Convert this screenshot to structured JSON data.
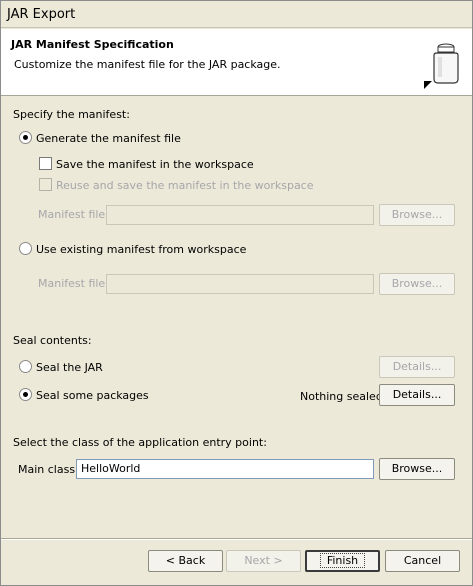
{
  "window": {
    "title": "JAR Export"
  },
  "header": {
    "title": "JAR Manifest Specification",
    "description": "Customize the manifest file for the JAR package."
  },
  "manifest": {
    "section_label": "Specify the manifest:",
    "generate_label": "Generate the manifest file",
    "generate_checked": true,
    "save_label": "Save the manifest in the workspace",
    "save_checked": false,
    "reuse_label": "Reuse and save the manifest in the workspace",
    "reuse_checked": false,
    "manifest_file_label_1": "Manifest file:",
    "manifest_file_value_1": "",
    "browse_label_1": "Browse...",
    "use_existing_label": "Use existing manifest from workspace",
    "use_existing_checked": false,
    "manifest_file_label_2": "Manifest file:",
    "manifest_file_value_2": "",
    "browse_label_2": "Browse..."
  },
  "seal": {
    "section_label": "Seal contents:",
    "seal_jar_label": "Seal the JAR",
    "seal_jar_checked": false,
    "details_label_1": "Details...",
    "seal_packages_label": "Seal some packages",
    "seal_packages_checked": true,
    "status_text": "Nothing sealed",
    "details_label_2": "Details..."
  },
  "entry": {
    "section_label": "Select the class of the application entry point:",
    "main_class_label": "Main class:",
    "main_class_value": "HelloWorld",
    "browse_label": "Browse..."
  },
  "footer": {
    "back_label": "< Back",
    "next_label": "Next >",
    "finish_label": "Finish",
    "cancel_label": "Cancel"
  },
  "icons": {
    "header": "jar-icon"
  }
}
